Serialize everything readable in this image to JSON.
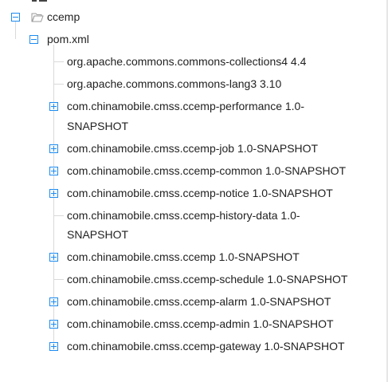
{
  "tree": {
    "root": {
      "label": "ccemp",
      "expanded": true,
      "icon": "folder-open-icon",
      "children": [
        {
          "label": "pom.xml",
          "expanded": true,
          "children": [
            {
              "label": "org.apache.commons.commons-collections4 4.4",
              "toggle": "none"
            },
            {
              "label": "org.apache.commons.commons-lang3 3.10",
              "toggle": "none"
            },
            {
              "label_line1": "com.chinamobile.cmss.ccemp-performance 1.0-",
              "label_line2": "SNAPSHOT",
              "toggle": "plus"
            },
            {
              "label": "com.chinamobile.cmss.ccemp-job 1.0-SNAPSHOT",
              "toggle": "plus"
            },
            {
              "label": "com.chinamobile.cmss.ccemp-common 1.0-SNAPSHOT",
              "toggle": "plus"
            },
            {
              "label": "com.chinamobile.cmss.ccemp-notice 1.0-SNAPSHOT",
              "toggle": "plus"
            },
            {
              "label_line1": "com.chinamobile.cmss.ccemp-history-data 1.0-",
              "label_line2": "SNAPSHOT",
              "toggle": "none"
            },
            {
              "label": "com.chinamobile.cmss.ccemp 1.0-SNAPSHOT",
              "toggle": "plus"
            },
            {
              "label": "com.chinamobile.cmss.ccemp-schedule 1.0-SNAPSHOT",
              "toggle": "none"
            },
            {
              "label": "com.chinamobile.cmss.ccemp-alarm 1.0-SNAPSHOT",
              "toggle": "plus"
            },
            {
              "label": "com.chinamobile.cmss.ccemp-admin 1.0-SNAPSHOT",
              "toggle": "plus"
            },
            {
              "label": "com.chinamobile.cmss.ccemp-gateway 1.0-SNAPSHOT",
              "toggle": "plus"
            }
          ]
        }
      ]
    }
  },
  "colors": {
    "accent": "#1e8bf0",
    "guide": "#d9d9d9",
    "text": "#222222"
  }
}
